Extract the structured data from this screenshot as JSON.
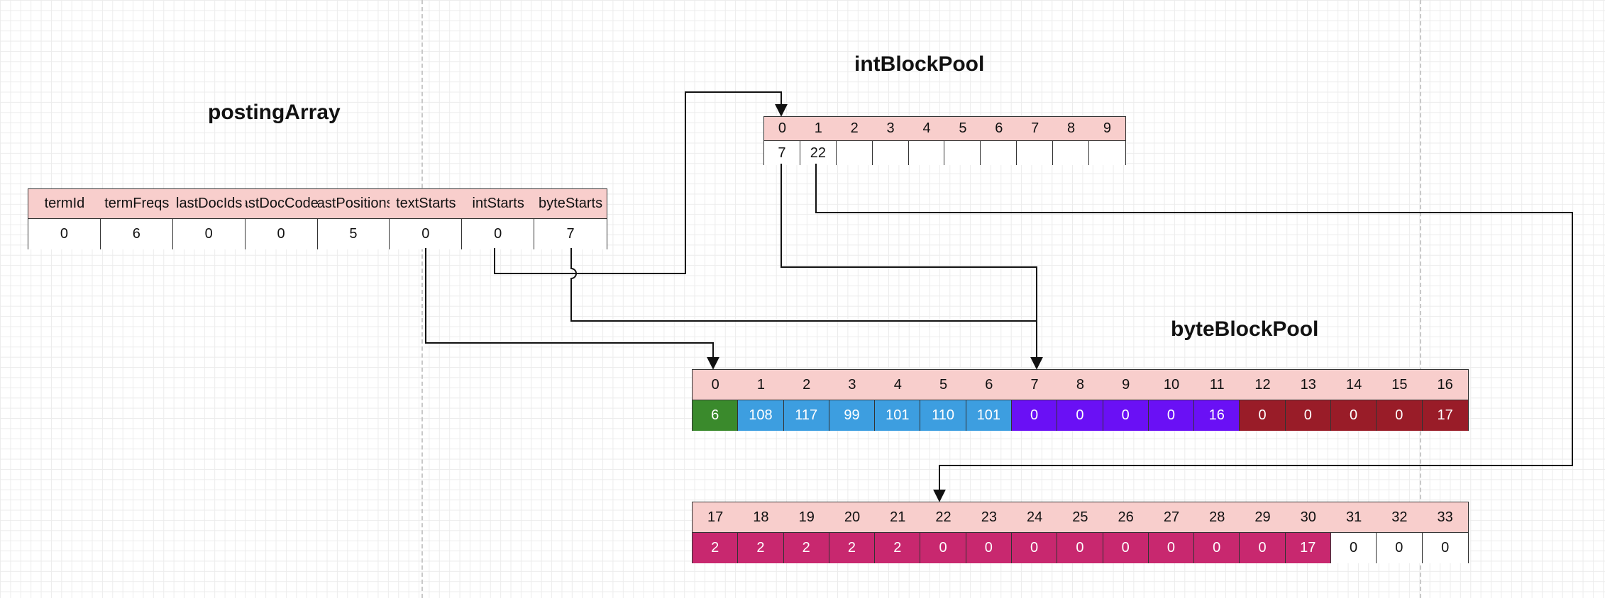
{
  "titles": {
    "posting": "postingArray",
    "int_pool": "intBlockPool",
    "byte_pool": "byteBlockPool"
  },
  "posting_array": {
    "headers": [
      "termId",
      "termFreqs",
      "lastDocIds",
      "lastDocCodes",
      "lastPositions",
      "textStarts",
      "intStarts",
      "byteStarts"
    ],
    "values": [
      "0",
      "6",
      "0",
      "0",
      "5",
      "0",
      "0",
      "7"
    ]
  },
  "int_block_pool": {
    "indices": [
      "0",
      "1",
      "2",
      "3",
      "4",
      "5",
      "6",
      "7",
      "8",
      "9"
    ],
    "values": [
      "7",
      "22",
      "",
      "",
      "",
      "",
      "",
      "",
      "",
      ""
    ]
  },
  "byte_block_pool": {
    "row1": {
      "indices": [
        "0",
        "1",
        "2",
        "3",
        "4",
        "5",
        "6",
        "7",
        "8",
        "9",
        "10",
        "11",
        "12",
        "13",
        "14",
        "15",
        "16"
      ],
      "values": [
        "6",
        "108",
        "117",
        "99",
        "101",
        "110",
        "101",
        "0",
        "0",
        "0",
        "0",
        "16",
        "0",
        "0",
        "0",
        "0",
        "17"
      ]
    },
    "row2": {
      "indices": [
        "17",
        "18",
        "19",
        "20",
        "21",
        "22",
        "23",
        "24",
        "25",
        "26",
        "27",
        "28",
        "29",
        "30",
        "31",
        "32",
        "33"
      ],
      "values": [
        "2",
        "2",
        "2",
        "2",
        "2",
        "0",
        "0",
        "0",
        "0",
        "0",
        "0",
        "0",
        "0",
        "17",
        "0",
        "0",
        "0"
      ]
    }
  },
  "colors": {
    "header_bg": "#f8cecc",
    "green": "#3a8a2c",
    "blue": "#3d9ee0",
    "violet": "#6a10f5",
    "dark_red": "#991c28",
    "magenta": "#c8286f",
    "white": "#ffffff",
    "line": "#111111"
  }
}
